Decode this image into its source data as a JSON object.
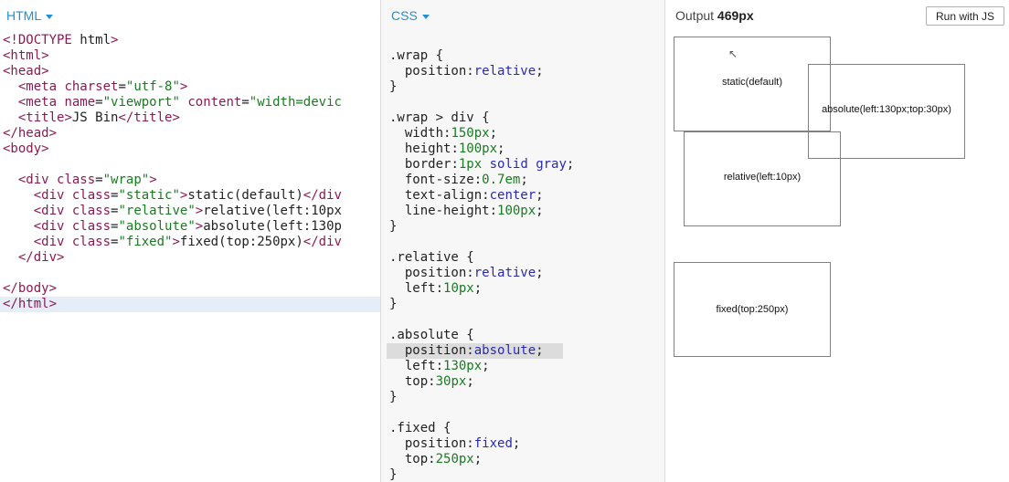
{
  "html_panel": {
    "title": "HTML",
    "lines": [
      "<!DOCTYPE html>",
      "<html>",
      "<head>",
      "  <meta charset=\"utf-8\">",
      "  <meta name=\"viewport\" content=\"width=devic",
      "  <title>JS Bin</title>",
      "</head>",
      "<body>",
      "",
      "  <div class=\"wrap\">",
      "    <div class=\"static\">static(default)</div",
      "    <div class=\"relative\">relative(left:10px",
      "    <div class=\"absolute\">absolute(left:130p",
      "    <div class=\"fixed\">fixed(top:250px)</div",
      "  </div>",
      "",
      "</body>",
      "</html>"
    ]
  },
  "css_panel": {
    "title": "CSS",
    "lines": [
      ".wrap {",
      "  position:relative;",
      "}",
      "",
      ".wrap > div {",
      "  width:150px;",
      "  height:100px;",
      "  border:1px solid gray;",
      "  font-size:0.7em;",
      "  text-align:center;",
      "  line-height:100px;",
      "}",
      "",
      ".relative {",
      "  position:relative;",
      "  left:10px;",
      "}",
      "",
      ".absolute {",
      "  position:absolute;",
      "  left:130px;",
      "  top:30px;",
      "}",
      "",
      ".fixed {",
      "  position:fixed;",
      "  top:250px;",
      "}"
    ]
  },
  "output": {
    "title_prefix": "Output",
    "width_label": "469px",
    "run_button": "Run with JS",
    "boxes": {
      "static": "static(default)",
      "absolute": "absolute(left:130px;top:30px)",
      "relative": "relative(left:10px)",
      "fixed": "fixed(top:250px)"
    }
  },
  "colors": {
    "accent": "#1e90d8",
    "tag": "#8a1a52",
    "string": "#1a7a22",
    "value": "#2a2ab0"
  }
}
